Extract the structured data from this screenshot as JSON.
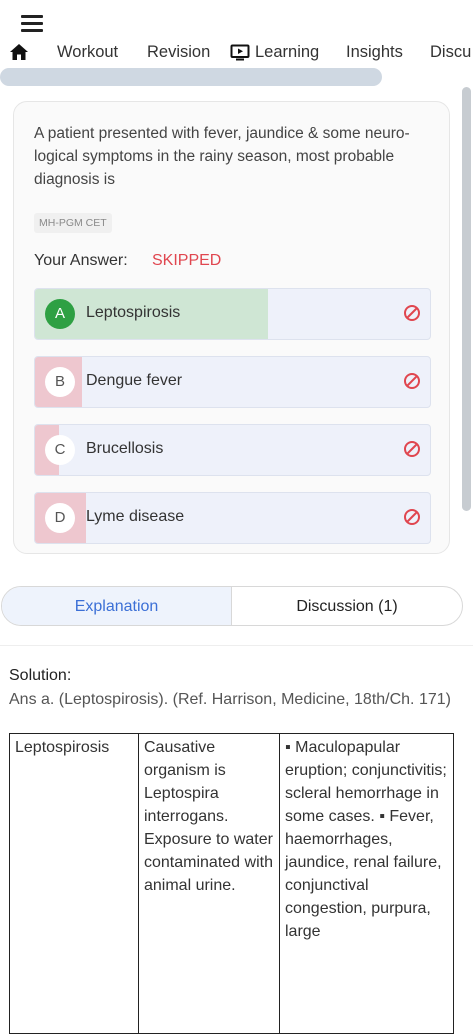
{
  "nav": {
    "tabs": [
      "Workout",
      "Revision",
      "Learning",
      "Insights",
      "Discu"
    ]
  },
  "question": {
    "text": "A patient presented with fever, jaundice & some neuro- logical symptoms in the rainy season, most probable diagnosis is",
    "source_tag": "MH-PGM CET",
    "answer_label": "Your Answer:",
    "answer_value": "SKIPPED",
    "options": [
      {
        "letter": "A",
        "text": "Leptospirosis",
        "percent": 59,
        "correct": true
      },
      {
        "letter": "B",
        "text": "Dengue fever",
        "percent": 12,
        "correct": false
      },
      {
        "letter": "C",
        "text": "Brucellosis",
        "percent": 6,
        "correct": false
      },
      {
        "letter": "D",
        "text": "Lyme disease",
        "percent": 13,
        "correct": false
      }
    ]
  },
  "tabs2": {
    "explanation": "Explanation",
    "discussion": "Discussion (1)"
  },
  "solution": {
    "title": "Solution:",
    "reference": "Ans a. (Leptospirosis). (Ref. Harrison, Medicine, 18th/Ch. 171)",
    "table_row": {
      "disease": "Leptospirosis",
      "cause": "Causative organism is Leptospira interrogans. Exposure to water contaminated with animal urine.",
      "features": "▪ Maculopapular eruption; conjunctivitis; scleral hemorrhage in some cases. ▪ Fever, haemorrhages, jaundice, renal failure, conjunctival congestion, purpura, large"
    }
  },
  "colors": {
    "correct_fill": "#cfe6d4",
    "wrong_fill": "#eec7cf",
    "accent_blue": "#3b6fd6",
    "skipped_red": "#e0464f"
  }
}
